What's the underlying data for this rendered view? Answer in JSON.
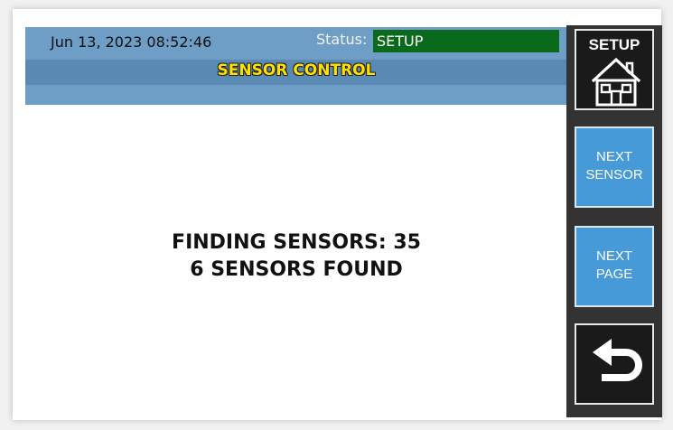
{
  "header": {
    "datetime": "Jun 13, 2023 08:52:46",
    "status_label": "Status:",
    "status_value": "SETUP",
    "title": "SENSOR CONTROL"
  },
  "main": {
    "message_line_1": "FINDING SENSORS: 35",
    "message_line_2": "6 SENSORS FOUND"
  },
  "side_panel": {
    "setup_label": "SETUP",
    "setup_icon": "house-icon",
    "next_sensor_line_1": "NEXT",
    "next_sensor_line_2": "SENSOR",
    "next_page_line_1": "NEXT",
    "next_page_line_2": "PAGE",
    "back_icon": "return-arrow-icon"
  },
  "colors": {
    "header_blue": "#6e9ec5",
    "header_band_blue": "#5a8ab4",
    "status_green": "#0a6a1b",
    "title_yellow": "#ffe100",
    "button_blue": "#479ad8",
    "side_panel_dark": "#333333"
  }
}
